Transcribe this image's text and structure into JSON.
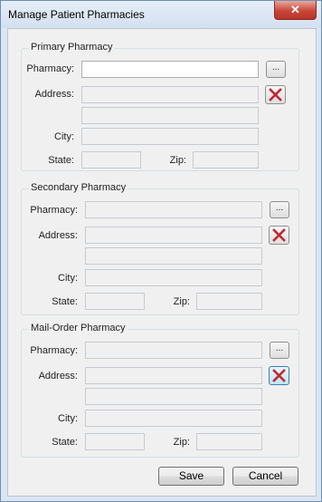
{
  "window": {
    "title": "Manage Patient Pharmacies",
    "close_glyph": "✕"
  },
  "groups": [
    {
      "title": "Primary Pharmacy",
      "labels": {
        "pharmacy": "Pharmacy:",
        "address": "Address:",
        "city": "City:",
        "state": "State:",
        "zip": "Zip:"
      },
      "values": {
        "pharmacy": "",
        "address1": "",
        "address2": "",
        "city": "",
        "state": "",
        "zip": ""
      }
    },
    {
      "title": "Secondary Pharmacy",
      "labels": {
        "pharmacy": "Pharmacy:",
        "address": "Address:",
        "city": "City:",
        "state": "State:",
        "zip": "Zip:"
      },
      "values": {
        "pharmacy": "",
        "address1": "",
        "address2": "",
        "city": "",
        "state": "",
        "zip": ""
      }
    },
    {
      "title": "Mail-Order Pharmacy",
      "labels": {
        "pharmacy": "Pharmacy:",
        "address": "Address:",
        "city": "City:",
        "state": "State:",
        "zip": "Zip:"
      },
      "values": {
        "pharmacy": "",
        "address1": "",
        "address2": "",
        "city": "",
        "state": "",
        "zip": ""
      }
    }
  ],
  "browse_label": "...",
  "buttons": {
    "save": "Save",
    "cancel": "Cancel"
  },
  "colors": {
    "delete_icon": "#c0282d",
    "close_button": "#c8473a"
  },
  "icons": {
    "browse": "ellipsis-icon",
    "delete": "red-x-icon",
    "close": "close-icon"
  }
}
